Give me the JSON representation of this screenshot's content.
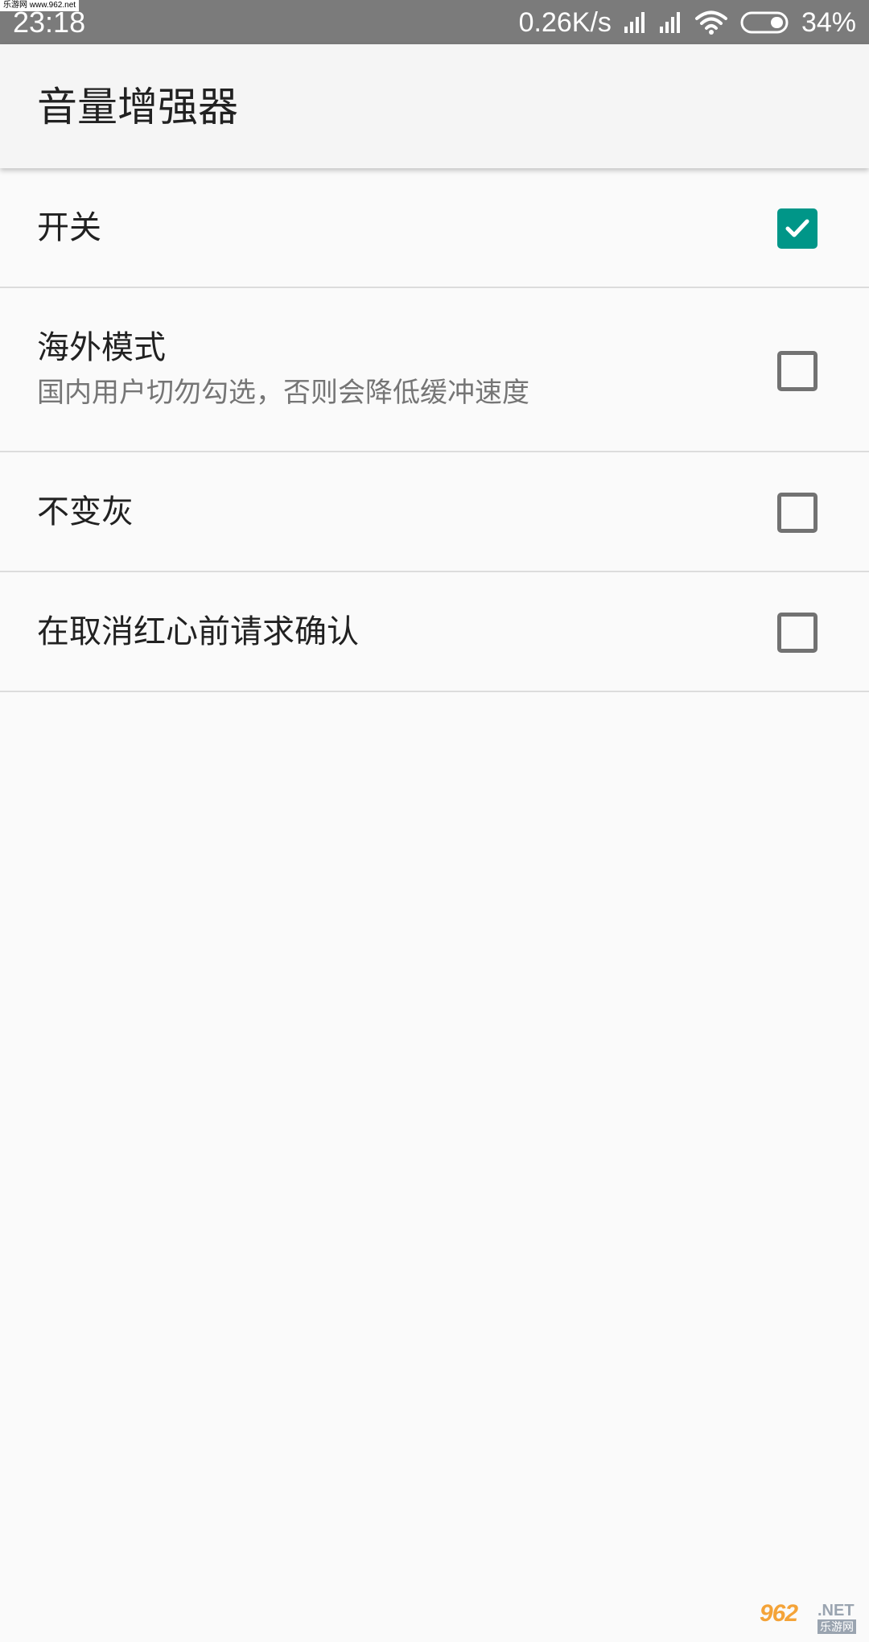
{
  "status_bar": {
    "watermark": "乐游网 www.962.net",
    "time": "23:18",
    "net_speed": "0.26K/s",
    "battery": "34%"
  },
  "app_bar": {
    "title": "音量增强器"
  },
  "preferences": [
    {
      "title": "开关",
      "summary": "",
      "checked": true
    },
    {
      "title": "海外模式",
      "summary": "国内用户切勿勾选，否则会降低缓冲速度",
      "checked": false
    },
    {
      "title": "不变灰",
      "summary": "",
      "checked": false
    },
    {
      "title": "在取消红心前请求确认",
      "summary": "",
      "checked": false
    }
  ],
  "watermark_bottom": {
    "number": "962",
    "net": ".NET",
    "cn": "乐游网"
  },
  "colors": {
    "accent": "#009688",
    "status_bar": "#7b7b7b",
    "app_bar": "#f5f5f5",
    "background": "#fafafa"
  }
}
